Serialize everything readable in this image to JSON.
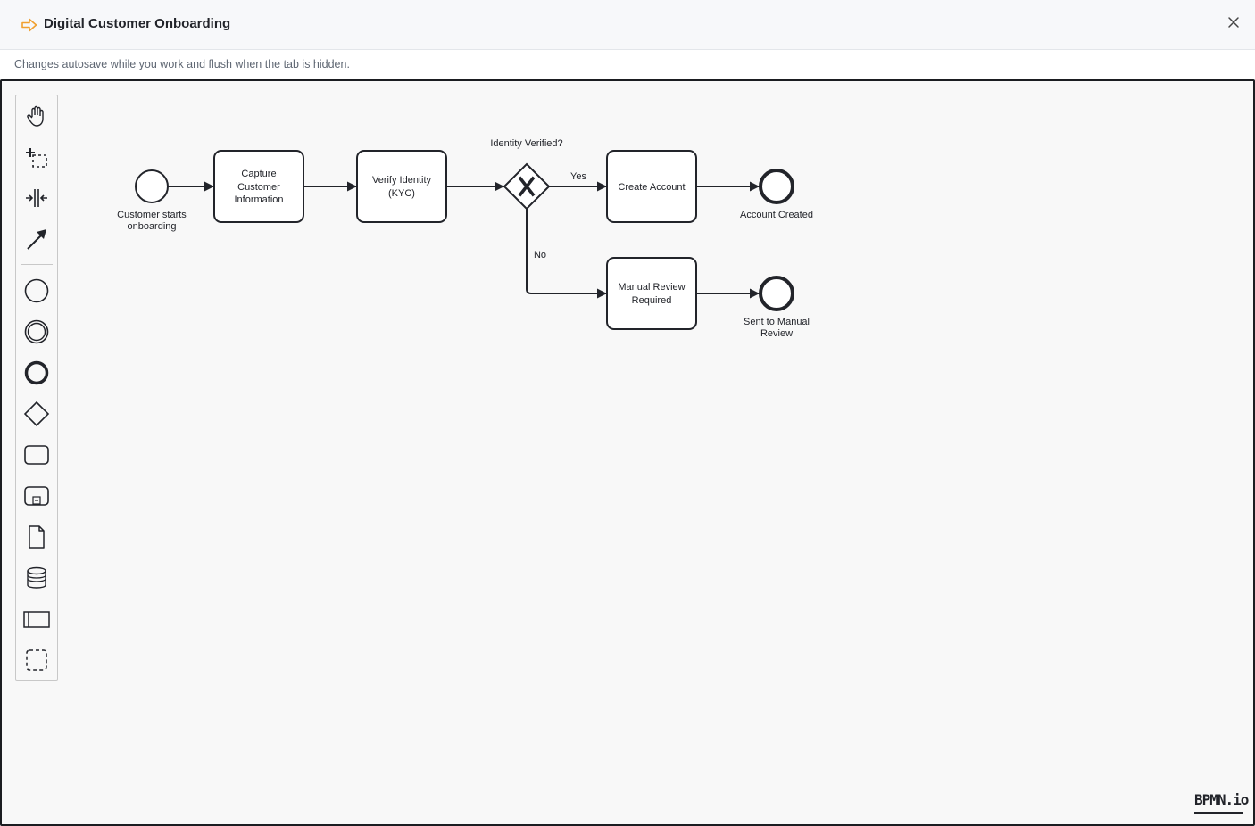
{
  "header": {
    "title": "Digital Customer Onboarding",
    "title_icon": "arrow-right-icon",
    "accent_color": "#f0a030",
    "close_icon": "close-icon"
  },
  "subbar": {
    "note": "Changes autosave while you work and flush when the tab is hidden."
  },
  "palette": {
    "tools": [
      "hand-tool-icon",
      "lasso-tool-icon",
      "space-tool-icon",
      "global-connect-tool-icon",
      "start-event-icon",
      "intermediate-event-icon",
      "end-event-icon",
      "gateway-icon",
      "task-icon",
      "subprocess-icon",
      "data-object-icon",
      "data-store-icon",
      "pool-icon",
      "group-icon"
    ]
  },
  "diagram": {
    "start_event_label_line1": "Customer starts",
    "start_event_label_line2": "onboarding",
    "task_capture_line1": "Capture",
    "task_capture_line2": "Customer",
    "task_capture_line3": "Information",
    "task_verify_line1": "Verify Identity",
    "task_verify_line2": "(KYC)",
    "gateway_label": "Identity Verified?",
    "flow_yes_label": "Yes",
    "flow_no_label": "No",
    "task_create_account": "Create Account",
    "task_manual_review_line1": "Manual Review",
    "task_manual_review_line2": "Required",
    "end_event_account_created": "Account Created",
    "end_event_manual_line1": "Sent to Manual",
    "end_event_manual_line2": "Review"
  },
  "watermark": {
    "logo_text": "BPMN.io"
  }
}
